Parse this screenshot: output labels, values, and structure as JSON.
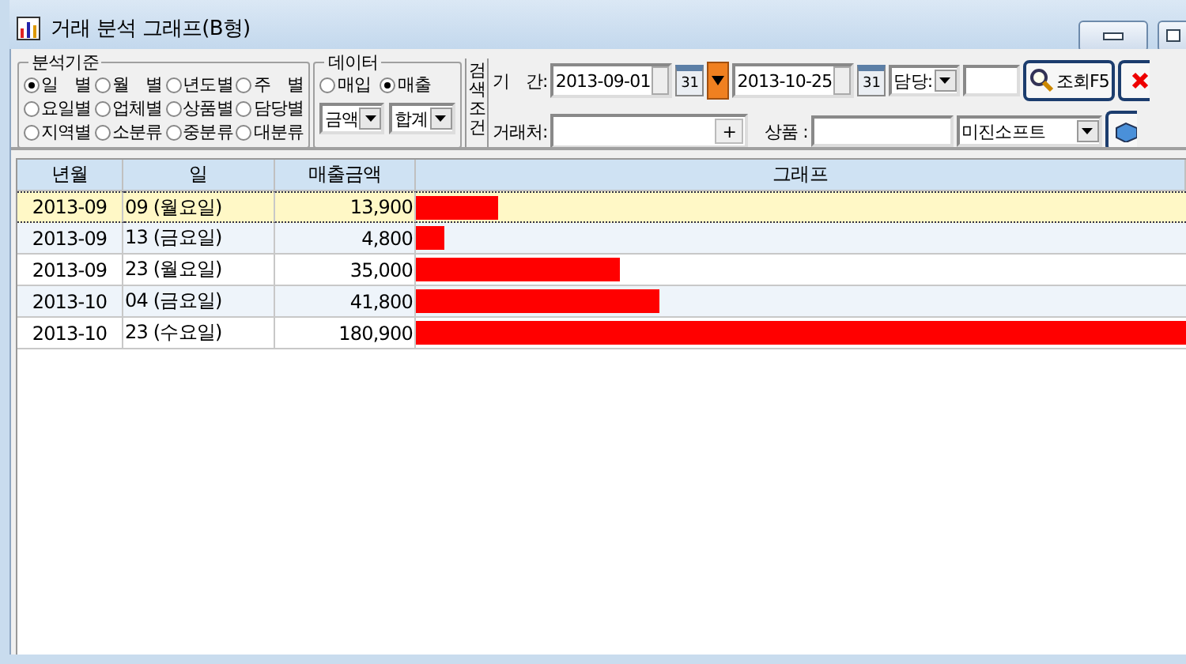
{
  "window": {
    "title": "거래 분석 그래프(B형)"
  },
  "criteria": {
    "title": "분석기준",
    "options": [
      {
        "label": "일　별",
        "selected": true
      },
      {
        "label": "월　별",
        "selected": false
      },
      {
        "label": "년도별",
        "selected": false
      },
      {
        "label": "주　별",
        "selected": false
      },
      {
        "label": "요일별",
        "selected": false
      },
      {
        "label": "업체별",
        "selected": false
      },
      {
        "label": "상품별",
        "selected": false
      },
      {
        "label": "담당별",
        "selected": false
      },
      {
        "label": "지역별",
        "selected": false
      },
      {
        "label": "소분류",
        "selected": false
      },
      {
        "label": "중분류",
        "selected": false
      },
      {
        "label": "대분류",
        "selected": false
      }
    ]
  },
  "data_group": {
    "title": "데이터",
    "options": [
      {
        "label": "매입",
        "selected": false
      },
      {
        "label": "매출",
        "selected": true
      }
    ],
    "dropdowns": [
      "금액",
      "합계"
    ]
  },
  "search": {
    "title": "검색조건",
    "period_label": "기　간:",
    "date_from": "2013-09-01",
    "date_to": "2013-10-25",
    "calendar_labels": [
      "31",
      "31"
    ],
    "manager_label": "담당:",
    "query_button": "조회F5",
    "client_label": "거래처:",
    "client_add": "+",
    "product_label": "상품 :",
    "company": "미진소프트"
  },
  "table": {
    "columns": [
      "년월",
      "일",
      "매출금액",
      "그래프"
    ],
    "rows": [
      {
        "month": "2013-09",
        "day": "09 (월요일)",
        "amount": "13,900",
        "level": 0.107,
        "selected": true
      },
      {
        "month": "2013-09",
        "day": "13 (금요일)",
        "amount": "4,800",
        "level": 0.037,
        "selected": false
      },
      {
        "month": "2013-09",
        "day": "23 (월요일)",
        "amount": "35,000",
        "level": 0.264,
        "selected": false
      },
      {
        "month": "2013-10",
        "day": "04 (금요일)",
        "amount": "41,800",
        "level": 0.316,
        "selected": false
      },
      {
        "month": "2013-10",
        "day": "23 (수요일)",
        "amount": "180,900",
        "level": 1.0,
        "selected": false
      }
    ]
  }
}
